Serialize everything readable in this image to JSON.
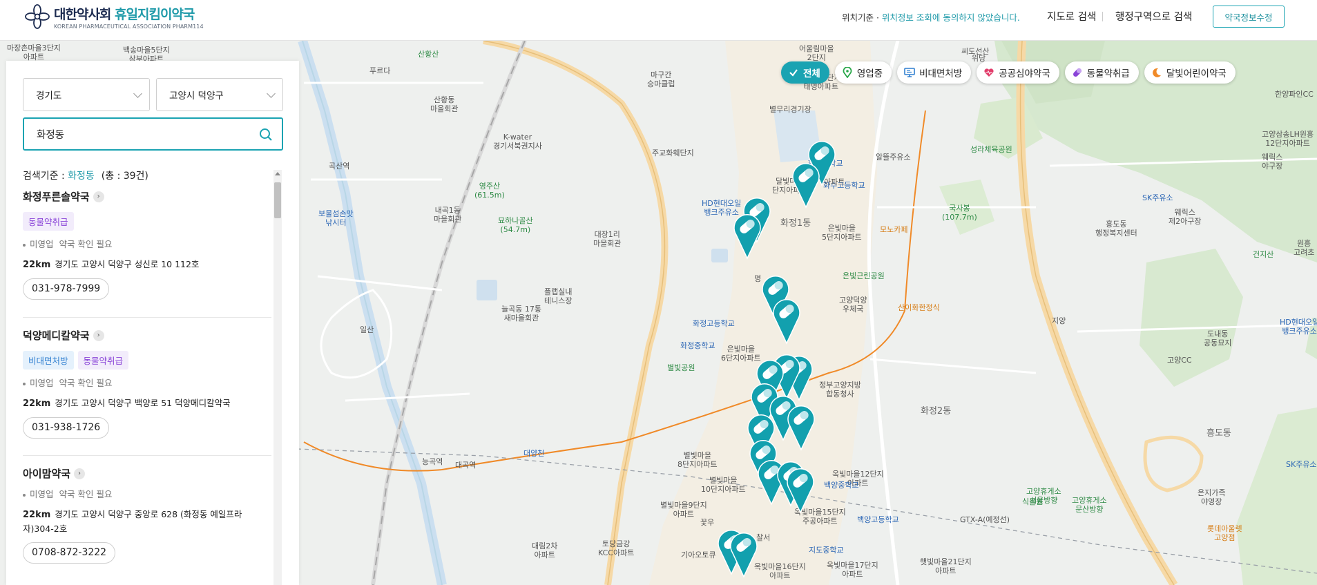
{
  "header": {
    "logo_main": "대한약사회",
    "logo_highlight": "휴일지킴이약국",
    "logo_sub": "KOREAN PHARMACEUTICAL ASSOCIATION PHARM114",
    "location_label": "위치기준 · ",
    "location_status": "위치정보 조회에 동의하지 않았습니다.",
    "nav_map": "지도로 검색",
    "nav_region": "행정구역으로 검색",
    "edit_button": "약국정보수정"
  },
  "filters": [
    {
      "label": "전체",
      "icon": "check-icon",
      "active": true
    },
    {
      "label": "영업중",
      "icon": "location-pin-icon",
      "active": false
    },
    {
      "label": "비대면처방",
      "icon": "monitor-icon",
      "active": false
    },
    {
      "label": "공공심야약국",
      "icon": "heart-icon",
      "active": false
    },
    {
      "label": "동물약취급",
      "icon": "pill-icon",
      "active": false
    },
    {
      "label": "달빛어린이약국",
      "icon": "moon-icon",
      "active": false
    }
  ],
  "search": {
    "province": "경기도",
    "city": "고양시 덕양구",
    "query": "화정동",
    "summary_label": "검색기준 : ",
    "summary_query": "화정동",
    "summary_count": "(총 : 39건)"
  },
  "results": [
    {
      "name": "화정푸른솔약국",
      "tags": [
        {
          "label": "동물약취급",
          "color": "purple"
        }
      ],
      "status": "미영업",
      "note": "약국 확인 필요",
      "distance": "22km",
      "address": "경기도 고양시 덕양구 성신로 10 112호",
      "phone": "031-978-7999"
    },
    {
      "name": "덕양메디칼약국",
      "tags": [
        {
          "label": "비대면처방",
          "color": "blue"
        },
        {
          "label": "동물약취급",
          "color": "purple"
        }
      ],
      "status": "미영업",
      "note": "약국 확인 필요",
      "distance": "22km",
      "address": "경기도 고양시 덕양구 백양로 51 덕양메디칼약국",
      "phone": "031-938-1726"
    },
    {
      "name": "아이맘약국",
      "tags": [],
      "status": "미영업",
      "note": "약국 확인 필요",
      "distance": "22km",
      "address": "경기도 고양시 덕양구 중앙로 628 (화정동 예일프라자)304-2호",
      "phone": "0708-872-3222"
    }
  ],
  "map_labels": {
    "l1": "마장촌마을3단지\n아파트",
    "l2": "백송마을5단지\n삼부아파트",
    "l3": "산황산",
    "l4": "푸르다",
    "l5": "산황동\n마을회관",
    "l6": "K-water\n경기서북권지사",
    "l7": "곡산역",
    "l8": "영주산\n(61.5m)",
    "l9": "내곡1동\n마을회관",
    "l10": "묘하나골산\n(54.7m)",
    "l11": "보물섬손맛\n낚시터",
    "l12": "마구간\n승마클럽",
    "l13": "주교화훼단지",
    "l14": "대장1리\n마을회관",
    "l15": "늘곡동 17통\n새마을회관",
    "l16": "플랩실내\n테니스장",
    "l17": "일산",
    "l18": "능곡역",
    "l19": "대곡역",
    "l20": "HD현대오일\n뱅크주유소",
    "l21": "어울림마을\n2단지",
    "l22": "신원당6단지\n태영아파트",
    "l23": "별무리경기장",
    "l24": "화수중학교",
    "l25": "화수고등학교",
    "l26": "달빛마을\n단지아파트",
    "l27": "화정1동",
    "l28": "은빛마을\n5단지아파트",
    "l29": "은빛근린공원",
    "l30": "고양덕양\n우체국",
    "l31": "정부고양지방\n합동청사",
    "l32": "은빛마을\n6단지아파트",
    "l33": "화정고등학교",
    "l34": "화정중학교",
    "l35": "별빛공원",
    "l36": "별빛마을\n8단지아파트",
    "l37": "별빛마을\n10단지아파트",
    "l38": "옥빛마을12단지\n아파트",
    "l39": "백양중학교",
    "l40": "별빛마을9단지\n아파트",
    "l41": "옥빛마을15단지\n주공아파트",
    "l42": "백양고등학교",
    "l43": "지도중학교",
    "l44": "기아오토큐",
    "l45": "대림2차\n아파트",
    "l46": "토당금강\nKCC아파트",
    "l47": "옥빛마을16단지\n아파트",
    "l48": "옥빛마을17단지\n아파트",
    "l49": "햇빛마을21단지\n아파트",
    "l50": "알뜰주유소",
    "l51": "성라체육공원",
    "l52": "국사봉\n(107.7m)",
    "l53": "모노카페",
    "l54": "산이화한정식",
    "l55": "화정2동",
    "l56": "SK주유소",
    "l57": "흥도동\n행정복지센터",
    "l58": "웨릭스\n제2아구장",
    "l59": "지양",
    "l60": "건지산",
    "l61": "한양파인CC",
    "l62": "고양삼송LH원흥\n12단지아파트",
    "l63": "웨릭스\n야구장",
    "l64": "HD현대오일\n뱅크주유소",
    "l65": "도내동\n공동묘지",
    "l66": "고양CC",
    "l67": "흥도동",
    "l68": "식물원",
    "l69": "고양휴게소\n서울방향",
    "l70": "고양휴게소\n문산방향",
    "l71": "은지가족\n야영장",
    "l72": "SK주유소",
    "l73": "롯데아울렛\n고양점",
    "l74": "씨도선산",
    "l75": "위당",
    "l76": "원흥\n고려초",
    "l77": "GTX-A(예정선)",
    "l78": "꽃우",
    "l79": "찰서",
    "l80": "대양천",
    "l81": "아파트",
    "l82": "명"
  },
  "colors": {
    "accent": "#1aa3b2",
    "marker": "#12a0ae",
    "purple_tag": "#8a44d8",
    "blue_tag": "#2f7fd0"
  }
}
